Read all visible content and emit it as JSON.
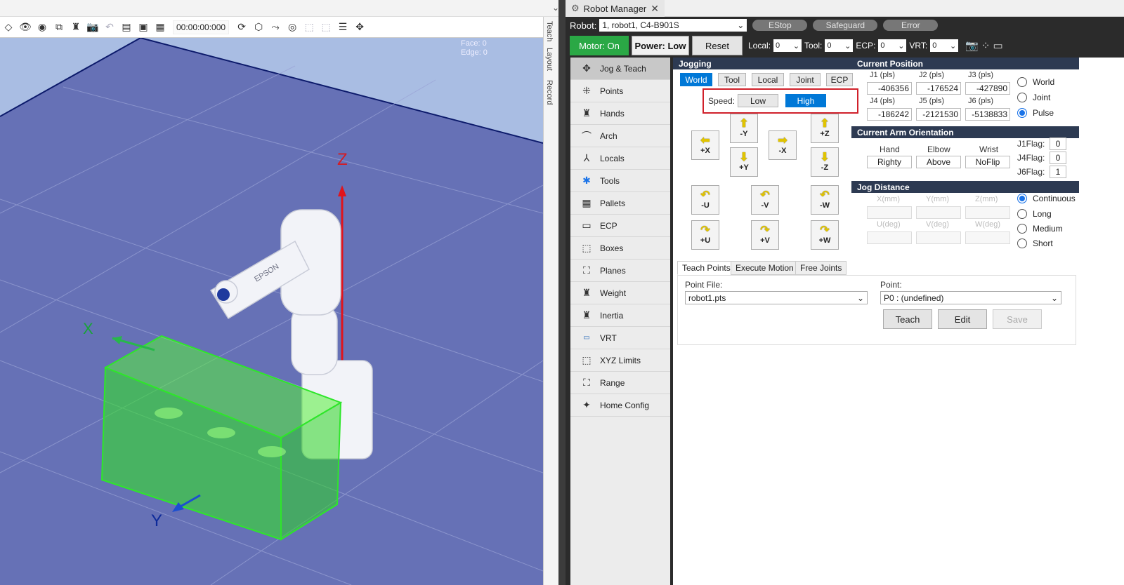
{
  "viewport": {
    "timecode": "00:00:00:000",
    "face_readout": "Face: 0",
    "edge_readout": "Edge: 0",
    "side_tabs": [
      "Teach",
      "Layout",
      "Record"
    ],
    "axis_labels": {
      "z": "Z",
      "x": "X",
      "y": "Y"
    },
    "robot_brand": "EPSON",
    "colors": {
      "floor": "#6671b6",
      "sky": "#a9bde3",
      "box": "#2ee62a"
    }
  },
  "robot_manager": {
    "title": "Robot Manager",
    "robot_label": "Robot:",
    "robot_value": "1, robot1, C4-B901S",
    "status": [
      "EStop",
      "Safeguard",
      "Error"
    ],
    "motor": "Motor: On",
    "power": "Power: Low",
    "reset": "Reset",
    "local_label": "Local:",
    "local_value": "0",
    "tool_label": "Tool:",
    "tool_value": "0",
    "ecp_label": "ECP:",
    "ecp_value": "0",
    "vrt_label": "VRT:",
    "vrt_value": "0"
  },
  "nav": [
    {
      "label": "Jog & Teach",
      "icon": "move-icon"
    },
    {
      "label": "Points",
      "icon": "points-icon"
    },
    {
      "label": "Hands",
      "icon": "hand-icon"
    },
    {
      "label": "Arch",
      "icon": "arch-icon"
    },
    {
      "label": "Locals",
      "icon": "axes-icon"
    },
    {
      "label": "Tools",
      "icon": "tool-icon"
    },
    {
      "label": "Pallets",
      "icon": "grid-icon"
    },
    {
      "label": "ECP",
      "icon": "ecp-icon"
    },
    {
      "label": "Boxes",
      "icon": "box-icon"
    },
    {
      "label": "Planes",
      "icon": "plane-icon"
    },
    {
      "label": "Weight",
      "icon": "weight-icon"
    },
    {
      "label": "Inertia",
      "icon": "inertia-icon"
    },
    {
      "label": "VRT",
      "icon": "vrt-icon"
    },
    {
      "label": "XYZ Limits",
      "icon": "limits-icon"
    },
    {
      "label": "Range",
      "icon": "range-icon"
    },
    {
      "label": "Home Config",
      "icon": "home-icon"
    }
  ],
  "jogging": {
    "header": "Jogging",
    "frames": [
      "World",
      "Tool",
      "Local",
      "Joint",
      "ECP"
    ],
    "selected_frame": "World",
    "speed_label": "Speed:",
    "speed_low": "Low",
    "speed_high": "High",
    "speed_selected": "High",
    "buttons": {
      "plus_x": "+X",
      "minus_y": "-Y",
      "minus_x": "-X",
      "plus_y": "+Y",
      "plus_z": "+Z",
      "minus_z": "-Z",
      "minus_u": "-U",
      "minus_v": "-V",
      "minus_w": "-W",
      "plus_u": "+U",
      "plus_v": "+V",
      "plus_w": "+W"
    }
  },
  "current_position": {
    "header": "Current Position",
    "labels": [
      "J1 (pls)",
      "J2 (pls)",
      "J3 (pls)",
      "J4 (pls)",
      "J5 (pls)",
      "J6 (pls)"
    ],
    "values": [
      "-406356",
      "-176524",
      "-427890",
      "-186242",
      "-2121530",
      "-5138833"
    ],
    "modes": [
      "World",
      "Joint",
      "Pulse"
    ],
    "selected_mode": "Pulse"
  },
  "arm_orientation": {
    "header": "Current Arm Orientation",
    "hand_label": "Hand",
    "hand_value": "Righty",
    "elbow_label": "Elbow",
    "elbow_value": "Above",
    "wrist_label": "Wrist",
    "wrist_value": "NoFlip",
    "j1flag_label": "J1Flag:",
    "j1flag_value": "0",
    "j4flag_label": "J4Flag:",
    "j4flag_value": "0",
    "j6flag_label": "J6Flag:",
    "j6flag_value": "1"
  },
  "jog_distance": {
    "header": "Jog Distance",
    "labels": [
      "X(mm)",
      "Y(mm)",
      "Z(mm)",
      "U(deg)",
      "V(deg)",
      "W(deg)"
    ],
    "options": [
      "Continuous",
      "Long",
      "Medium",
      "Short"
    ],
    "selected": "Continuous"
  },
  "lower_tabs": [
    "Teach Points",
    "Execute Motion",
    "Free Joints"
  ],
  "teach_points": {
    "point_file_label": "Point File:",
    "point_file_value": "robot1.pts",
    "point_label": "Point:",
    "point_value": "P0 : (undefined)",
    "teach": "Teach",
    "edit": "Edit",
    "save": "Save"
  }
}
